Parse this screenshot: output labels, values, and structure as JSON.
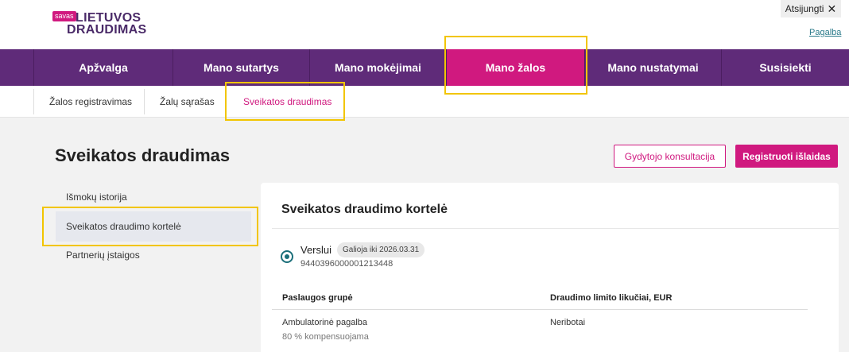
{
  "logo": {
    "badge": "savas",
    "line1": "LIETUVOS",
    "line2": "DRAUDIMAS"
  },
  "header": {
    "logout_label": "Atsijungti",
    "logout_icon": "✕",
    "help_label": "Pagalba"
  },
  "main_nav": {
    "items": [
      {
        "label": "Apžvalga"
      },
      {
        "label": "Mano sutartys"
      },
      {
        "label": "Mano mokėjimai"
      },
      {
        "label": "Mano žalos"
      },
      {
        "label": "Mano nustatymai"
      },
      {
        "label": "Susisiekti"
      }
    ],
    "active": "Mano žalos"
  },
  "sub_nav": {
    "items": [
      {
        "label": "Žalos registravimas"
      },
      {
        "label": "Žalų sąrašas"
      },
      {
        "label": "Sveikatos draudimas"
      }
    ],
    "active": "Sveikatos draudimas"
  },
  "page": {
    "title": "Sveikatos draudimas",
    "consult_button": "Gydytojo konsultacija",
    "register_button": "Registruoti išlaidas"
  },
  "sidebar": {
    "items": [
      {
        "label": "Išmokų istorija"
      },
      {
        "label": "Sveikatos draudimo kortelė"
      },
      {
        "label": "Partnerių įstaigos"
      }
    ],
    "active": "Sveikatos draudimo kortelė"
  },
  "card": {
    "title": "Sveikatos draudimo kortelė",
    "plan": {
      "name": "Verslui",
      "validity": "Galioja iki 2026.03.31",
      "number": "9440396000001213448",
      "selected": true
    },
    "table": {
      "headers": [
        "Paslaugos grupė",
        "Draudimo limito likučiai, EUR"
      ],
      "rows": [
        {
          "group": "Ambulatorinė pagalba",
          "note": "80 % kompensuojama",
          "limit": "Neribotai"
        }
      ]
    }
  },
  "colors": {
    "brand_purple": "#5f2b79",
    "brand_magenta": "#d0197f",
    "radio_teal": "#1b6f7a",
    "highlight": "#f2c500"
  }
}
